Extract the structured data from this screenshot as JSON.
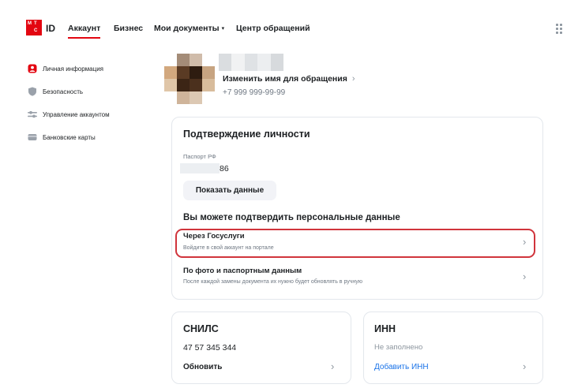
{
  "header": {
    "logo_letters": [
      "М",
      "Т",
      "С"
    ],
    "logo_id": "ID",
    "nav": [
      {
        "label": "Аккаунт",
        "active": true
      },
      {
        "label": "Бизнес"
      },
      {
        "label": "Мои документы",
        "caret": "▾"
      },
      {
        "label": "Центр обращений"
      }
    ],
    "accent_color": "#e30611"
  },
  "sidebar": {
    "items": [
      {
        "label": "Личная информация",
        "icon": "user-icon"
      },
      {
        "label": "Безопасность",
        "icon": "shield-icon"
      },
      {
        "label": "Управление аккаунтом",
        "icon": "sliders-icon"
      },
      {
        "label": "Банковские карты",
        "icon": "card-icon"
      }
    ]
  },
  "profile": {
    "change_name": "Изменить имя для обращения",
    "chevron": "›",
    "phone": "+7 999 999-99-99"
  },
  "identity": {
    "title": "Подтверждение личности",
    "passport_label": "Паспорт РФ",
    "passport_value": "86",
    "show_button": "Показать данные",
    "confirm_title": "Вы можете подтвердить персональные данные",
    "options": [
      {
        "title": "Через Госуслуги",
        "subtitle": "Войдите в свой аккаунт на портале"
      },
      {
        "title": "По фото и паспортным данным",
        "subtitle": "После каждой замены документа их нужно будет обновлять в ручную"
      }
    ],
    "highlight_color": "#d0343c"
  },
  "snils": {
    "title": "СНИЛС",
    "value": "47 57 345 344",
    "action": "Обновить"
  },
  "inn": {
    "title": "ИНН",
    "status": "Не заполнено",
    "action": "Добавить ИНН",
    "link_color": "#1a73e8"
  }
}
